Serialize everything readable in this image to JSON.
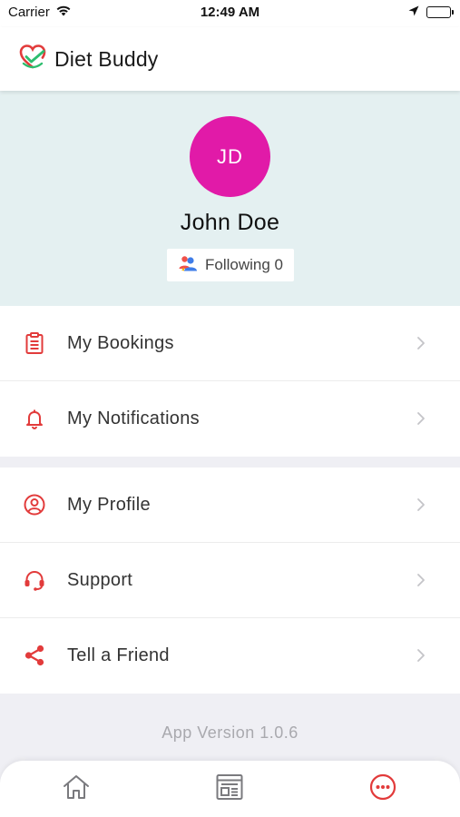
{
  "status_bar": {
    "carrier": "Carrier",
    "time": "12:49 AM"
  },
  "header": {
    "title": "Diet Buddy"
  },
  "profile": {
    "initials": "JD",
    "name": "John Doe",
    "following_label": "Following 0",
    "avatar_color": "#e11aa8"
  },
  "menu": {
    "group1": [
      {
        "label": "My Bookings",
        "icon": "clipboard-icon"
      },
      {
        "label": "My Notifications",
        "icon": "bell-icon"
      }
    ],
    "group2": [
      {
        "label": "My Profile",
        "icon": "user-circle-icon"
      },
      {
        "label": "Support",
        "icon": "headset-icon"
      },
      {
        "label": "Tell a Friend",
        "icon": "share-icon"
      }
    ]
  },
  "footer": {
    "version": "App Version 1.0.6"
  },
  "tabs": [
    {
      "name": "home",
      "icon": "home-icon",
      "active": false
    },
    {
      "name": "feed",
      "icon": "news-icon",
      "active": false
    },
    {
      "name": "more",
      "icon": "more-icon",
      "active": true
    }
  ],
  "colors": {
    "accent": "#e23b3b",
    "profile_bg": "#e4f0f1",
    "logo_green": "#2dbd6e"
  }
}
